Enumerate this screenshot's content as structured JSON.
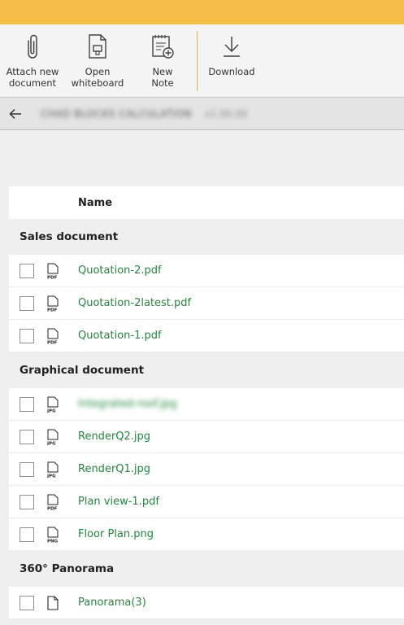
{
  "toolbar": {
    "attach_label": "Attach new\ndocument",
    "whiteboard_label": "Open\nwhiteboard",
    "note_label": "New\nNote",
    "download_label": "Download"
  },
  "breadcrumb": {
    "title": "CHAD BLOCKS CALCULATION",
    "subtitle": "v1.00.00"
  },
  "table": {
    "name_header": "Name"
  },
  "groups": [
    {
      "label": "Sales document",
      "files": [
        {
          "name": "Quotation-2.pdf",
          "type": "PDF"
        },
        {
          "name": "Quotation-2latest.pdf",
          "type": "PDF"
        },
        {
          "name": "Quotation-1.pdf",
          "type": "PDF"
        }
      ]
    },
    {
      "label": "Graphical document",
      "files": [
        {
          "name": "Integrated-roof.jpg",
          "type": "JPG"
        },
        {
          "name": "RenderQ2.jpg",
          "type": "JPG"
        },
        {
          "name": "RenderQ1.jpg",
          "type": "JPG"
        },
        {
          "name": "Plan view-1.pdf",
          "type": "PDF"
        },
        {
          "name": "Floor Plan.png",
          "type": "PNG"
        }
      ]
    },
    {
      "label": "360° Panorama",
      "files": [
        {
          "name": "Panorama(3)",
          "type": ""
        }
      ]
    }
  ],
  "colors": {
    "accent_bar": "#f5bd47",
    "file_link": "#1f8a3b"
  }
}
